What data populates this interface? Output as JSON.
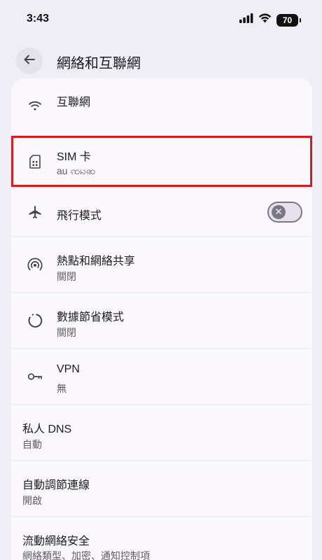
{
  "status_bar": {
    "time": "3:43",
    "battery": "70"
  },
  "header": {
    "title": "網絡和互聯網"
  },
  "items": [
    {
      "title": "互聯網",
      "subtitle": "",
      "icon": "wifi-icon"
    },
    {
      "title": "SIM 卡",
      "subtitle": "au ꩡꩢꩣ",
      "icon": "sim-card-icon"
    },
    {
      "title": "飛行模式",
      "subtitle": "",
      "icon": "airplane-icon",
      "toggle": false
    },
    {
      "title": "熱點和網絡共享",
      "subtitle": "關閉",
      "icon": "hotspot-icon"
    },
    {
      "title": "數據節省模式",
      "subtitle": "關閉",
      "icon": "data-saver-icon"
    },
    {
      "title": "VPN",
      "subtitle": "無",
      "icon": "vpn-key-icon"
    },
    {
      "title": "私人 DNS",
      "subtitle": "自動"
    },
    {
      "title": "自動調節連線",
      "subtitle": "開啟"
    },
    {
      "title": "流動網絡安全",
      "subtitle": "網絡類型、加密、通知控制項"
    }
  ],
  "colors": {
    "highlight_border": "#d11e1e",
    "card_bg": "#fbf8fd",
    "page_bg": "#efedf5"
  }
}
